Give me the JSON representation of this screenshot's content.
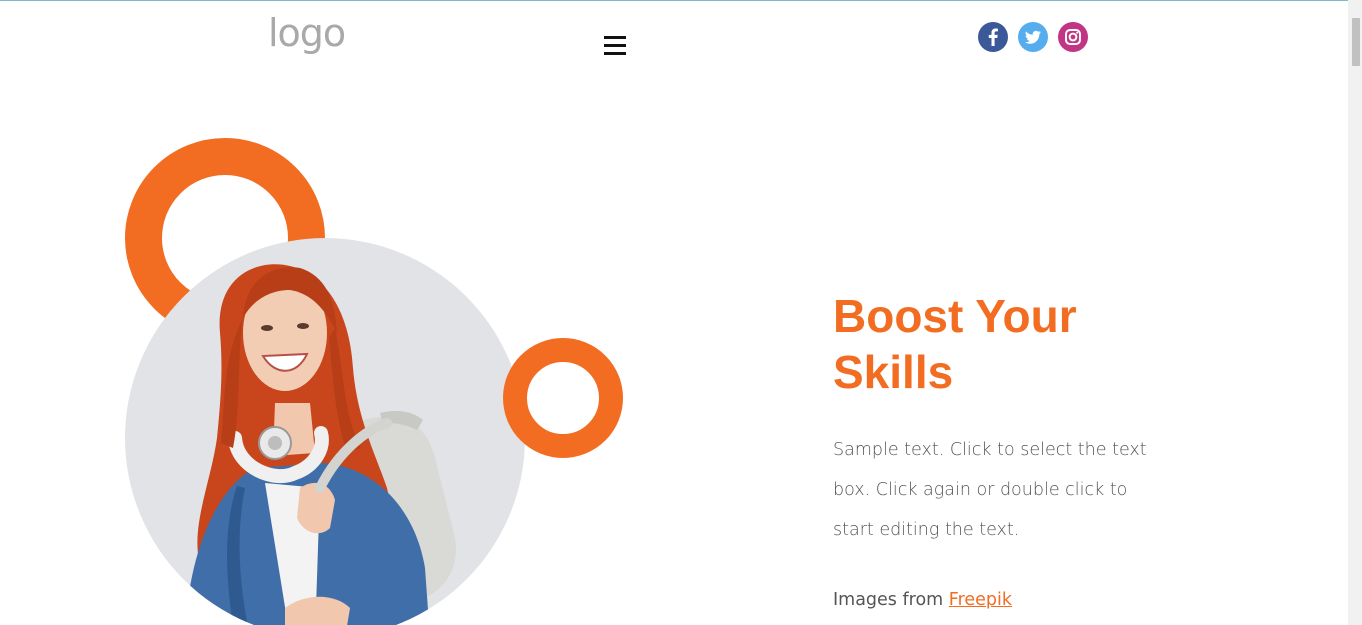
{
  "header": {
    "logo_text": "logo",
    "menu_icon": "hamburger-menu-icon",
    "social": [
      {
        "name": "facebook",
        "icon": "facebook-icon",
        "color": "#3b5998"
      },
      {
        "name": "twitter",
        "icon": "twitter-icon",
        "color": "#55acee"
      },
      {
        "name": "instagram",
        "icon": "instagram-icon",
        "color": "#c13584"
      }
    ]
  },
  "hero": {
    "title": "Boost Your Skills",
    "body": "Sample text. Click to select the text box. Click again or double click to start editing the text.",
    "credit_prefix": "Images from ",
    "credit_link": "Freepik"
  },
  "colors": {
    "accent": "#f26d22",
    "body_text": "#555555",
    "logo_gray": "#a9a9a9",
    "photo_bg": "#e2e3e7"
  }
}
